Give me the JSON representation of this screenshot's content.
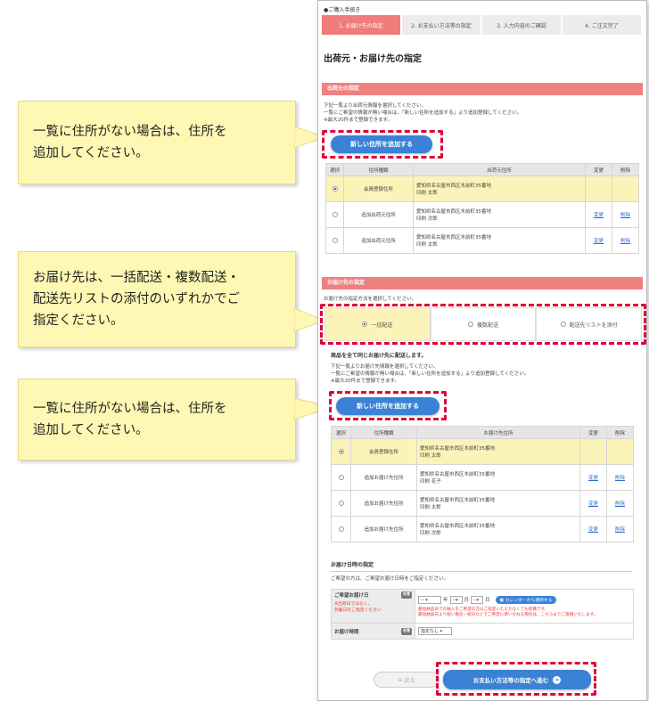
{
  "steps": {
    "heading": "●ご購入手続き",
    "items": [
      "1. お届け先の指定",
      "2. お支払い方法等の指定",
      "3. 入力内容のご確認",
      "4. ご注文完了"
    ]
  },
  "page_title": "出荷元・お届け先の指定",
  "shipfrom": {
    "bar": "出荷元の指定",
    "notes": [
      "下記一覧より出荷元情報を選択してください。",
      "一覧にご希望の情報が無い場合は、「新しい住所を追加する」より追加登録してください。",
      "※最大20件まで登録できます。"
    ],
    "add_button": "新しい住所を追加する",
    "headers": [
      "選択",
      "住所種類",
      "出荷元住所",
      "変更",
      "削除"
    ],
    "rows": [
      {
        "type": "会員登録住所",
        "addr": "愛知県名古屋市西区木前町35番地",
        "name": "印刷 太郎",
        "edit": "",
        "del": ""
      },
      {
        "type": "追加出荷元住所",
        "addr": "愛知県名古屋市西区木前町35番地",
        "name": "印刷 次郎",
        "edit": "変更",
        "del": "削除"
      },
      {
        "type": "追加出荷元住所",
        "addr": "愛知県名古屋市西区木前町35番地",
        "name": "印刷 太郎",
        "edit": "変更",
        "del": "削除"
      }
    ]
  },
  "delivery": {
    "bar": "お届け先の指定",
    "intro": "お届け先の指定方法を選択してください。",
    "tabs": [
      "一括配送",
      "複数配送",
      "配送先リストを添付"
    ],
    "subtitle": "商品を全て同じお届け先に配送します。",
    "notes": [
      "下記一覧よりお届け先情報を選択してください。",
      "一覧にご希望の情報が無い場合は、「新しい住所を追加する」より追加登録してください。",
      "※最大20件まで登録できます。"
    ],
    "add_button": "新しい住所を追加する",
    "headers": [
      "選択",
      "住所種類",
      "お届け先住所",
      "変更",
      "削除"
    ],
    "rows": [
      {
        "type": "会員登録住所",
        "addr": "愛知県名古屋市西区木前町35番地",
        "name": "印刷 太郎",
        "edit": "",
        "del": ""
      },
      {
        "type": "追加お届け先住所",
        "addr": "愛知県名古屋市西区木前町35番地",
        "name": "印刷 花子",
        "edit": "変更",
        "del": "削除"
      },
      {
        "type": "追加お届け先住所",
        "addr": "愛知県名古屋市西区木前町35番地",
        "name": "印刷 太郎",
        "edit": "変更",
        "del": "削除"
      },
      {
        "type": "追加お届け先住所",
        "addr": "愛知県名古屋市西区木前町35番地",
        "name": "印刷 次郎",
        "edit": "変更",
        "del": "削除"
      }
    ]
  },
  "datetime": {
    "title": "お届け日時の指定",
    "intro": "ご希望の方は、ご希望お届け日時をご指定ください。",
    "date_label": "ご希望お届け日",
    "date_badge": "任意",
    "date_note1": "※出荷日ではなく、",
    "date_note2": "到着日をご指定ください",
    "year_value": "--",
    "year_unit": "年",
    "month_value": "--",
    "month_unit": "月",
    "day_value": "--",
    "day_unit": "日",
    "calendar_button": "カレンダーから選択する",
    "warn1": "最短納品日での納入をご希望の方はご指定いただかなくても結構です。",
    "warn2": "最短納品日より短い場合・祝日などでご希望に添いかねる場合は、こちらよりご連絡いたします。",
    "time_label": "お届け時間",
    "time_badge": "任意",
    "time_value": "指定なし"
  },
  "footer": {
    "back": "戻る",
    "next": "お支払い方法等の指定へ進む"
  },
  "callouts": {
    "c1_line1": "一覧に住所がない場合は、住所を",
    "c1_line2": "追加してください。",
    "c2_line1": "お届け先は、一括配送・複数配送・",
    "c2_line2": "配送先リストの添付のいずれかでご",
    "c2_line3": "指定ください。",
    "c3_line1": "一覧に住所がない場合は、住所を",
    "c3_line2": "追加してください。"
  },
  "colors": {
    "accent": "#f08080",
    "button": "#3b82d6",
    "highlight": "#e0003a",
    "callout": "#fff8b4"
  }
}
